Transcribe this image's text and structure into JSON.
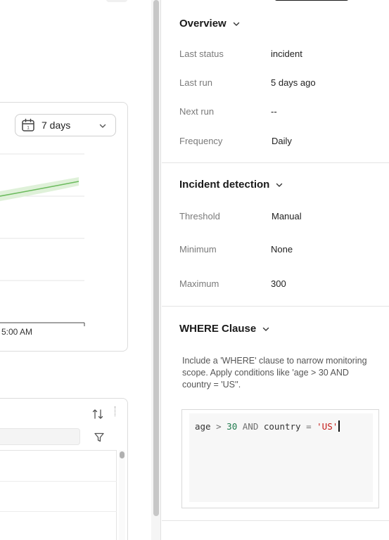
{
  "left": {
    "range_select": {
      "label": "7 days"
    },
    "chart": {
      "x_tick": "5:00 AM",
      "line_color": "#6cbb5e",
      "band_color": "#dff1d9"
    }
  },
  "panel": {
    "overview": {
      "title": "Overview",
      "rows": [
        {
          "label": "Last status",
          "value": "incident"
        },
        {
          "label": "Last run",
          "value": "5 days ago"
        },
        {
          "label": "Next run",
          "value": "--"
        },
        {
          "label": "Frequency",
          "value": "Daily"
        }
      ]
    },
    "incident": {
      "title": "Incident detection",
      "rows": [
        {
          "label": "Threshold",
          "value": "Manual"
        },
        {
          "label": "Minimum",
          "value": "None"
        },
        {
          "label": "Maximum",
          "value": "300"
        }
      ]
    },
    "where": {
      "title": "WHERE Clause",
      "description": "Include a 'WHERE' clause to narrow monitoring scope. Apply conditions like 'age > 30 AND country = 'US''.",
      "code": {
        "t1": "age",
        "t2": ">",
        "t3": "30",
        "t4": "AND",
        "t5": "country",
        "t6": "=",
        "t7": "'US'"
      }
    }
  }
}
